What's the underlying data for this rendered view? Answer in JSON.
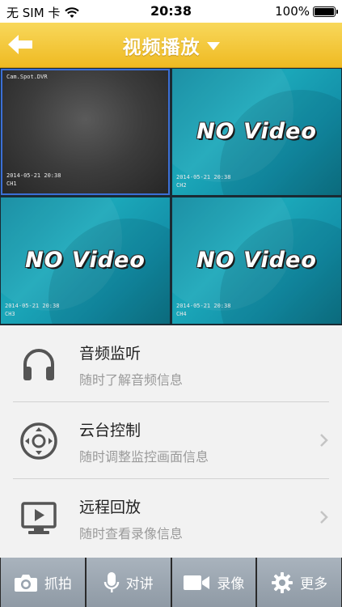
{
  "status_bar": {
    "carrier": "无 SIM 卡",
    "time": "20:38",
    "battery": "100%"
  },
  "nav": {
    "title": "视频播放",
    "back_icon": "back-arrow-icon",
    "dropdown_icon": "caret-down-icon"
  },
  "video_grid": {
    "cells": [
      {
        "state": "camera",
        "osd_top": "Cam.Spot.DVR",
        "osd_line1": "2014-05-21 20:38",
        "osd_line2": "CH1"
      },
      {
        "state": "no_video",
        "label": "NO Video",
        "osd_line1": "2014-05-21 20:38",
        "osd_line2": "CH2"
      },
      {
        "state": "no_video",
        "label": "NO Video",
        "osd_line1": "2014-05-21 20:38",
        "osd_line2": "CH3"
      },
      {
        "state": "no_video",
        "label": "NO Video",
        "osd_line1": "2014-05-21 20:38",
        "osd_line2": "CH4"
      }
    ]
  },
  "features": [
    {
      "title": "音频监听",
      "subtitle": "随时了解音频信息",
      "icon": "headphones-icon",
      "has_chevron": false
    },
    {
      "title": "云台控制",
      "subtitle": "随时调整监控画面信息",
      "icon": "ptz-control-icon",
      "has_chevron": true
    },
    {
      "title": "远程回放",
      "subtitle": "随时查看录像信息",
      "icon": "playback-monitor-icon",
      "has_chevron": true
    }
  ],
  "toolbar": {
    "snapshot": "抓拍",
    "talk": "对讲",
    "record": "录像",
    "more": "更多"
  },
  "colors": {
    "nav_gradient_top": "#f8d85b",
    "nav_gradient_bottom": "#efba22",
    "selected_cell_border": "#3b6fd6",
    "no_video_bg": "#1ba7b9",
    "toolbar_button": "#9ca6b0"
  }
}
